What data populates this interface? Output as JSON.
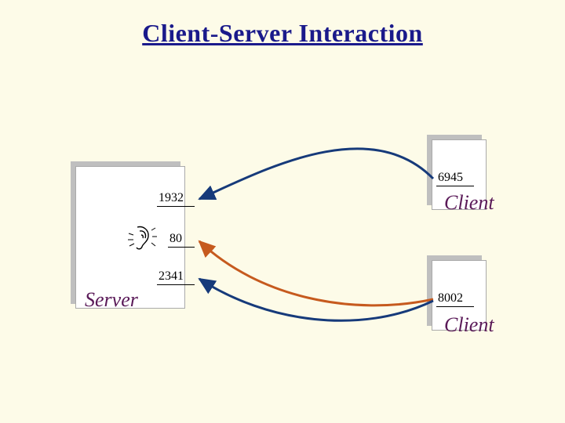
{
  "title": "Client-Server Interaction",
  "server": {
    "label": "Server",
    "ports": {
      "p1932": "1932",
      "p80": "80",
      "p2341": "2341"
    }
  },
  "client1": {
    "label": "Client",
    "port": "6945"
  },
  "client2": {
    "label": "Client",
    "port": "8002"
  },
  "colors": {
    "arrow_blue": "#163a7a",
    "arrow_orange": "#c65a1e",
    "title": "#1a1a8b",
    "label": "#5a1a58"
  },
  "chart_data": {
    "type": "diagram",
    "title": "Client-Server Interaction",
    "nodes": [
      {
        "id": "server",
        "label": "Server",
        "ports": [
          1932,
          80,
          2341
        ]
      },
      {
        "id": "client1",
        "label": "Client",
        "ports": [
          6945
        ]
      },
      {
        "id": "client2",
        "label": "Client",
        "ports": [
          8002
        ]
      }
    ],
    "edges": [
      {
        "from": "client1",
        "from_port": 6945,
        "to": "server",
        "to_port": 1932,
        "color": "blue"
      },
      {
        "from": "client2",
        "from_port": 8002,
        "to": "server",
        "to_port": 80,
        "color": "orange"
      },
      {
        "from": "client2",
        "from_port": 8002,
        "to": "server",
        "to_port": 2341,
        "color": "blue"
      }
    ],
    "annotations": [
      {
        "at": "server",
        "port": 80,
        "icon": "ear",
        "meaning": "listening port"
      }
    ]
  }
}
